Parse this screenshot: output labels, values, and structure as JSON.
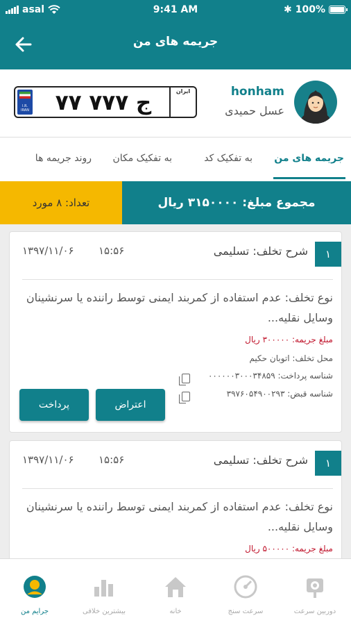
{
  "status_bar": {
    "carrier": "asal",
    "time": "9:41 AM",
    "battery": "100%",
    "battery_level": 1.0
  },
  "header": {
    "title": "جریمه های من"
  },
  "profile": {
    "username": "honham",
    "full_name": "عسل حمیدی",
    "plate": {
      "number": "۷۷ ج ۷۷۷",
      "iran_label": "ایران",
      "region": "",
      "flag_code": "I.R. IRAN"
    }
  },
  "tabs": [
    {
      "label": "جریمه های من",
      "active": true
    },
    {
      "label": "به تفکیک کد",
      "active": false
    },
    {
      "label": "به تفکیک مکان",
      "active": false
    },
    {
      "label": "روند جریمه ها",
      "active": false
    }
  ],
  "summary": {
    "total": "مجموع مبلغ: ۳۱۵۰۰۰۰ ریال",
    "count": "تعداد: ۸ مورد"
  },
  "fines": [
    {
      "index": "۱",
      "description": "شرح تخلف: تسلیمی",
      "time": "۱۵:۵۶",
      "date": "۱۳۹۷/۱۱/۰۶",
      "type": "نوع تخلف: عدم استفاده از کمربند ایمنی توسط راننده یا سرنشینان وسایل نقلیه...",
      "amount": "مبلغ جریمه: ۳۰۰۰۰۰ ریال",
      "location": "محل تخلف: اتوبان حکیم",
      "payment_id": "شناسه پرداخت: ۰۰۰۰۰۰۳۰۰۰۳۴۸۵۹",
      "bill_id": "شناسه قبض: ۳۹۷۶۰۵۴۹۰۰۲۹۳",
      "objection_label": "اعتراض",
      "pay_label": "پرداخت"
    },
    {
      "index": "۱",
      "description": "شرح تخلف: تسلیمی",
      "time": "۱۵:۵۶",
      "date": "۱۳۹۷/۱۱/۰۶",
      "type": "نوع تخلف: عدم استفاده از کمربند ایمنی توسط راننده یا سرنشینان وسایل نقلیه...",
      "amount": "مبلغ جریمه: ۵۰۰۰۰۰ ریال"
    }
  ],
  "bottom_nav": [
    {
      "label": "جرایم من",
      "icon": "user-icon",
      "active": true
    },
    {
      "label": "بیشترین خلافی",
      "icon": "bar-chart-icon",
      "active": false
    },
    {
      "label": "خانه",
      "icon": "home-icon",
      "active": false
    },
    {
      "label": "سرعت سنج",
      "icon": "speedometer-icon",
      "active": false
    },
    {
      "label": "دوربین سرعت",
      "icon": "speed-camera-icon",
      "active": false
    }
  ],
  "colors": {
    "primary": "#11808b",
    "accent": "#f5b800",
    "fine_amount": "#c0142b"
  }
}
